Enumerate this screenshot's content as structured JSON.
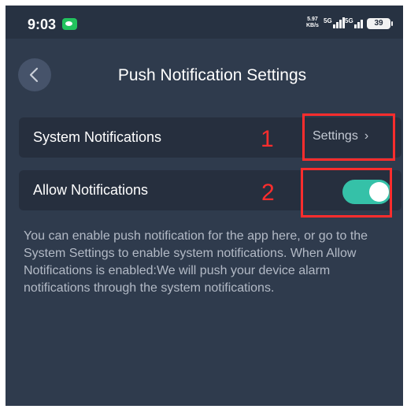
{
  "status_bar": {
    "time": "9:03",
    "net_speed": "5.97",
    "net_unit": "KB/s",
    "sim1_gen": "5G",
    "sim2_gen": "5G",
    "battery": "39",
    "wechat_icon": "wechat-icon"
  },
  "header": {
    "back_icon": "chevron-left-icon",
    "title": "Push Notification Settings"
  },
  "rows": [
    {
      "label": "System Notifications",
      "action_label": "Settings",
      "action_icon": "chevron-right-icon"
    },
    {
      "label": "Allow Notifications",
      "toggle_on": true,
      "toggle_color": "#35c1a8"
    }
  ],
  "annotations": {
    "marker_1": "1",
    "marker_2": "2",
    "color": "#ff2d2d"
  },
  "description": "You can enable push notification for the app here, or go to the System Settings to enable system notifications. When Allow Notifications is enabled:We will push your device alarm notifications through the system notifications."
}
